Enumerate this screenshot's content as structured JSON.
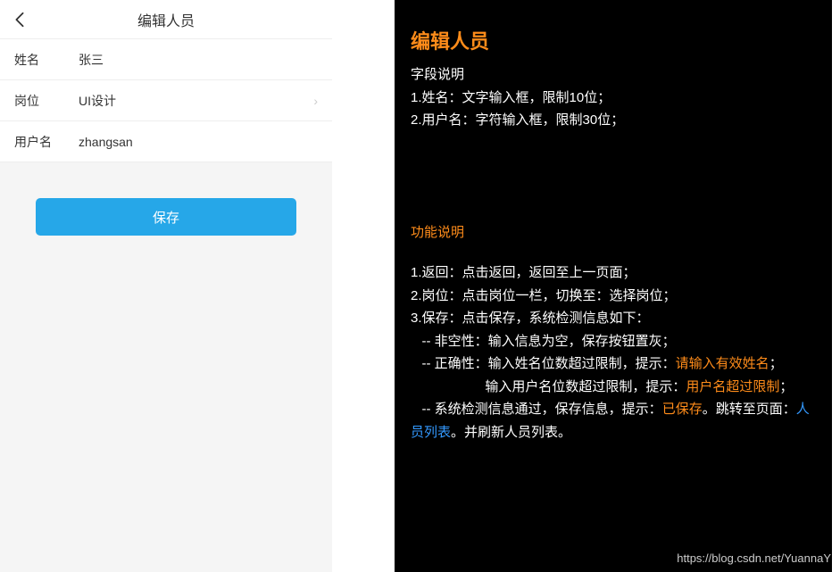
{
  "mobile": {
    "title": "编辑人员",
    "fields": {
      "name_label": "姓名",
      "name_value": "张三",
      "position_label": "岗位",
      "position_value": "UI设计",
      "username_label": "用户名",
      "username_value": "zhangsan"
    },
    "save_label": "保存"
  },
  "spec": {
    "title": "编辑人员",
    "field_desc_header": "字段说明",
    "field_desc_1": "1.姓名：文字输入框，限制10位；",
    "field_desc_2": "2.用户名：字符输入框，限制30位；",
    "function_header": "功能说明",
    "func_1": "1.返回：点击返回，返回至上一页面；",
    "func_2": "2.岗位：点击岗位一栏，切换至：选择岗位；",
    "func_3": "3.保存：点击保存，系统检测信息如下：",
    "func_3a": "   -- 非空性：输入信息为空，保存按钮置灰；",
    "func_3b_prefix": "   -- 正确性：输入姓名位数超过限制，提示：",
    "func_3b_hint": "请输入有效姓名",
    "func_3b_suffix": "；",
    "func_3c_prefix": "                    输入用户名位数超过限制，提示：",
    "func_3c_hint": "用户名超过限制",
    "func_3c_suffix": "；",
    "func_3d_prefix": "   -- 系统检测信息通过，保存信息，提示：",
    "func_3d_hint": "已保存",
    "func_3d_mid": "。跳转至页面：",
    "func_3d_link": "人员列表",
    "func_3d_suffix": "。并刷新人员列表。"
  },
  "watermark": "https://blog.csdn.net/YuannaY"
}
